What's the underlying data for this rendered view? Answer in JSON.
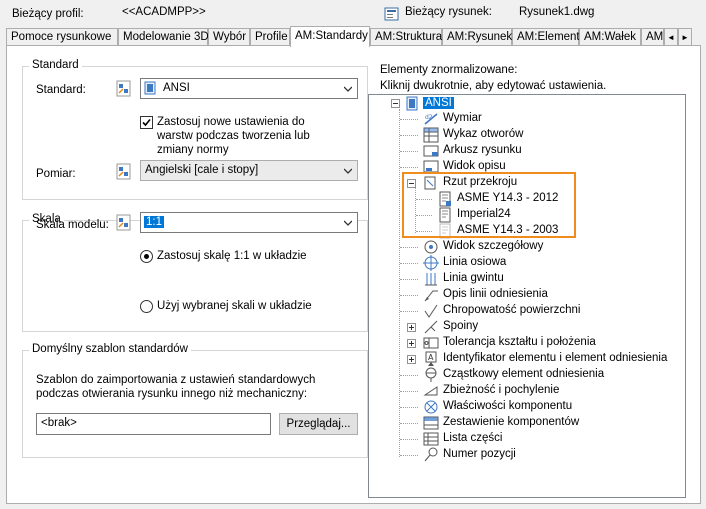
{
  "header": {
    "profile_label": "Bieżący profil:",
    "profile_value": "<<ACADMPP>>",
    "drawing_label": "Bieżący rysunek:",
    "drawing_value": "Rysunek1.dwg"
  },
  "tabs": [
    {
      "label": "Pomoce rysunkowe"
    },
    {
      "label": "Modelowanie 3D"
    },
    {
      "label": "Wybór"
    },
    {
      "label": "Profile"
    },
    {
      "label": "AM:Standardy"
    },
    {
      "label": "AM:Struktura"
    },
    {
      "label": "AM:Rysunek"
    },
    {
      "label": "AM:Element"
    },
    {
      "label": "AM:Wałek"
    },
    {
      "label": "AM"
    }
  ],
  "tab_scroll": {
    "left": "◄",
    "right": "►"
  },
  "standard_group": {
    "title": "Standard",
    "standard_label": "Standard:",
    "standard_value": "ANSI",
    "checkbox_label_1": "Zastosuj nowe ustawienia do",
    "checkbox_label_2": "warstw podczas tworzenia lub",
    "checkbox_label_3": "zmiany normy",
    "checkbox_checked": true,
    "measure_label": "Pomiar:",
    "measure_value": "Angielski [cale i stopy]"
  },
  "scale_group": {
    "title": "Skala",
    "model_scale_label": "Skala modelu:",
    "model_scale_value": "1:1",
    "radio_1": "Zastosuj skalę 1:1 w układzie",
    "radio_2": "Użyj wybranej skali w układzie"
  },
  "template_group": {
    "title": "Domyślny szablon standardów",
    "desc_1": "Szablon do zaimportowania z ustawień standardowych",
    "desc_2": "podczas otwierania rysunku innego niż mechaniczny:",
    "path_value": "<brak>",
    "browse_button": "Przeglądaj..."
  },
  "elements": {
    "title": "Elementy znormalizowane:",
    "hint": "Kliknij dwukrotnie, aby edytować ustawienia.",
    "root": "ANSI",
    "items": [
      "Wymiar",
      "Wykaz otworów",
      "Arkusz rysunku",
      "Widok opisu",
      "Rzut przekroju",
      "ASME Y14.3 - 2012",
      "Imperial24",
      "ASME Y14.3 - 2003",
      "Widok szczegółowy",
      "Linia osiowa",
      "Linia gwintu",
      "Opis linii odniesienia",
      "Chropowatość powierzchni",
      "Spoiny",
      "Tolerancja kształtu i położenia",
      "Identyfikator elementu i element odniesienia",
      "Cząstkowy element odniesienia",
      "Zbieżność i pochylenie",
      "Właściwości komponentu",
      "Zestawienie komponentów",
      "Lista części",
      "Numer pozycji"
    ]
  },
  "colors": {
    "highlight_box": "#f08c1e",
    "selection": "#0078d7"
  }
}
